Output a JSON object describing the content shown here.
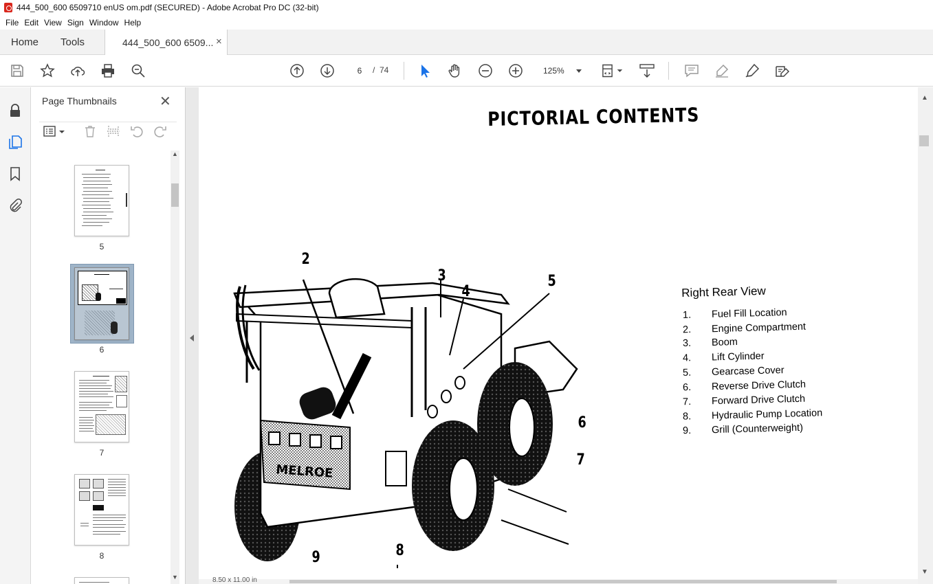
{
  "window": {
    "title": "444_500_600 6509710 enUS om.pdf (SECURED) - Adobe Acrobat Pro DC (32-bit)"
  },
  "menu": [
    "File",
    "Edit",
    "View",
    "Sign",
    "Window",
    "Help"
  ],
  "tabs": {
    "home": "Home",
    "tools": "Tools",
    "document": "444_500_600 6509...",
    "close": "×"
  },
  "toolbar": {
    "current_page": "6",
    "page_separator": "/",
    "total_pages": "74",
    "zoom": "125%",
    "icons": [
      "save-icon",
      "bookmark-star-icon",
      "upload-icon",
      "print-icon",
      "find-icon",
      "page-up-icon",
      "page-down-icon",
      "select-cursor-icon",
      "hand-icon",
      "zoom-out-icon",
      "zoom-in-icon",
      "page-display-icon",
      "scroll-mode-icon",
      "comment-icon",
      "highlight-icon",
      "sign-icon",
      "redact-edit-icon"
    ]
  },
  "left_rail": {
    "icons": [
      "lock-icon",
      "pages-icon",
      "bookmark-icon",
      "attachment-icon"
    ]
  },
  "thumbnails_panel": {
    "title": "Page Thumbnails",
    "close": "✕",
    "pages": [
      {
        "label": "5",
        "selected": false
      },
      {
        "label": "6",
        "selected": true
      },
      {
        "label": "7",
        "selected": false
      },
      {
        "label": "8",
        "selected": false
      }
    ]
  },
  "document": {
    "heading": "PICTORIAL CONTENTS",
    "legend_title": "Right Rear View",
    "legend_items": [
      {
        "num": "1.",
        "text": "Fuel Fill Location"
      },
      {
        "num": "2.",
        "text": "Engine Compartment"
      },
      {
        "num": "3.",
        "text": "Boom"
      },
      {
        "num": "4.",
        "text": "Lift Cylinder"
      },
      {
        "num": "5.",
        "text": "Gearcase Cover"
      },
      {
        "num": "6.",
        "text": "Reverse Drive Clutch"
      },
      {
        "num": "7.",
        "text": "Forward Drive Clutch"
      },
      {
        "num": "8.",
        "text": "Hydraulic Pump Location"
      },
      {
        "num": "9.",
        "text": "Grill (Counterweight)"
      }
    ],
    "callouts": [
      "2",
      "3",
      "4",
      "5",
      "6",
      "7",
      "8",
      "9"
    ],
    "grill_text": "MELROE",
    "page_size": "8.50 x 11.00 in"
  },
  "colors": {
    "accent": "#1a73e8",
    "pdf_red": "#d9261c",
    "selected_thumb_bg": "#9fb4c8"
  }
}
